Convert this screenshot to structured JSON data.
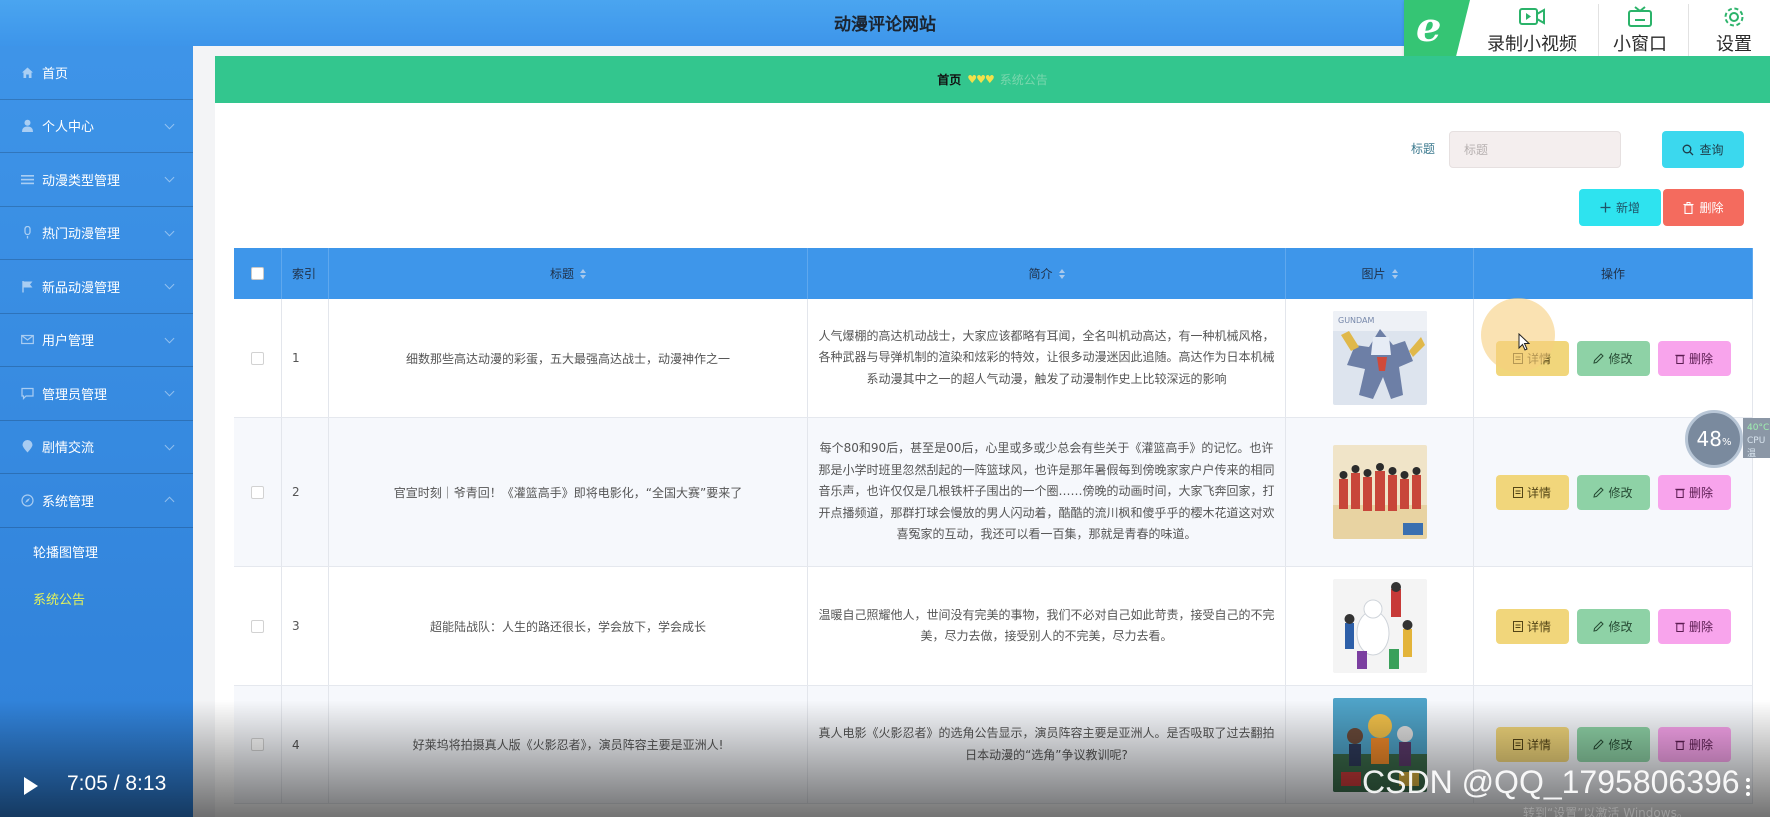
{
  "header": {
    "title": "动漫评论网站"
  },
  "recorder": {
    "record_label": "录制小视频",
    "window_label": "小窗口",
    "settings_label": "设置"
  },
  "sidebar": {
    "items": [
      {
        "label": "首页",
        "icon": "home-icon",
        "has_chevron": false
      },
      {
        "label": "个人中心",
        "icon": "user-icon",
        "has_chevron": true
      },
      {
        "label": "动漫类型管理",
        "icon": "list-icon",
        "has_chevron": true
      },
      {
        "label": "热门动漫管理",
        "icon": "mic-icon",
        "has_chevron": true
      },
      {
        "label": "新品动漫管理",
        "icon": "flag-icon",
        "has_chevron": true
      },
      {
        "label": "用户管理",
        "icon": "mail-icon",
        "has_chevron": true
      },
      {
        "label": "管理员管理",
        "icon": "chat-icon",
        "has_chevron": true
      },
      {
        "label": "剧情交流",
        "icon": "location-icon",
        "has_chevron": true
      },
      {
        "label": "系统管理",
        "icon": "compass-icon",
        "has_chevron": true
      }
    ],
    "subitems": [
      {
        "label": "轮播图管理",
        "active": false
      },
      {
        "label": "系统公告",
        "active": true
      }
    ],
    "active_color": "#e3f25a"
  },
  "breadcrumb": {
    "home": "首页",
    "separator": "♥♥♥",
    "current": "系统公告"
  },
  "search": {
    "label": "标题",
    "placeholder": "标题",
    "query_label": "查询"
  },
  "actions": {
    "add_label": "新增",
    "delete_label": "删除"
  },
  "table": {
    "columns": [
      "索引",
      "标题",
      "简介",
      "图片",
      "操作"
    ],
    "row_buttons": {
      "detail": "详情",
      "edit": "修改",
      "delete": "删除"
    },
    "rows": [
      {
        "index": "1",
        "title": "细数那些高达动漫的彩蛋，五大最强高达战士，动漫神作之一",
        "desc": "人气爆棚的高达机动战士，大家应该都略有耳闻，全名叫机动高达，有一种机械风格，各种武器与导弹机制的渲染和炫彩的特效，让很多动漫迷因此追随。高达作为日本机械系动漫其中之一的超人气动漫，触发了动漫制作史上比较深远的影响"
      },
      {
        "index": "2",
        "title": "官宣时刻｜爷青回！《灌篮高手》即将电影化，“全国大赛”要来了",
        "desc": "每个80和90后，甚至是00后，心里或多或少总会有些关于《灌篮高手》的记忆。也许那是小学时班里忽然刮起的一阵篮球风，也许是那年暑假每到傍晚家家户户传来的相同音乐声，也许仅仅是几根铁杆子围出的一个圈……傍晚的动画时间，大家飞奔回家，打开点播频道，那群打球会慢放的男人闪动着，酷酷的流川枫和傻乎乎的樱木花道这对欢喜冤家的互动，我还可以看一百集，那就是青春的味道。"
      },
      {
        "index": "3",
        "title": "超能陆战队：人生的路还很长，学会放下，学会成长",
        "desc": "温暖自己照耀他人，世间没有完美的事物，我们不必对自己如此苛责，接受自己的不完美，尽力去做，接受别人的不完美，尽力去看。"
      },
      {
        "index": "4",
        "title": "好莱坞将拍摄真人版《火影忍者》，演员阵容主要是亚洲人!",
        "desc": "真人电影《火影忍者》的选角公告显示，演员阵容主要是亚洲人。是否吸取了过去翻拍日本动漫的“选角”争议教训呢?"
      }
    ]
  },
  "cpu": {
    "percent": "48",
    "unit": "%",
    "temp": "40°C",
    "label": "CPU温"
  },
  "video": {
    "time": "7:05 / 8:13",
    "watermark": "CSDN @QQ_1795806396",
    "os_notice": "转到“设置”以激活 Windows。"
  },
  "colors": {
    "header": "#4aa5f0",
    "sidebar": "#3e94e8",
    "breadcrumb": "#33c68e",
    "table_header": "#3e96ea"
  }
}
